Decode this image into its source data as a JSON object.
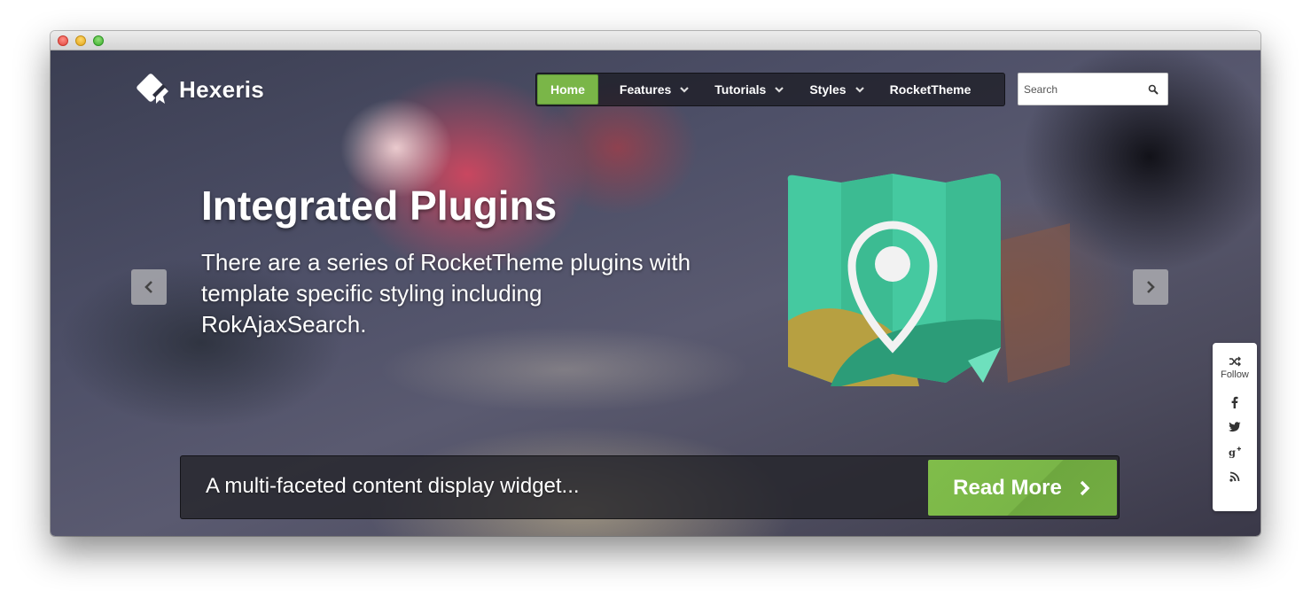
{
  "brand": {
    "name": "Hexeris",
    "accent_color": "#7ab648"
  },
  "nav": {
    "items": [
      {
        "label": "Home",
        "active": true,
        "has_dropdown": false
      },
      {
        "label": "Features",
        "active": false,
        "has_dropdown": true
      },
      {
        "label": "Tutorials",
        "active": false,
        "has_dropdown": true
      },
      {
        "label": "Styles",
        "active": false,
        "has_dropdown": true
      },
      {
        "label": "RocketTheme",
        "active": false,
        "has_dropdown": false
      }
    ]
  },
  "search": {
    "placeholder": "Search",
    "icon": "search-icon"
  },
  "slide": {
    "title": "Integrated Plugins",
    "description": "There are a series of RocketTheme plugins with template specific styling including RokAjaxSearch.",
    "illustration": "map-pin-icon",
    "prev_icon": "chevron-left-icon",
    "next_icon": "chevron-right-icon"
  },
  "caption": {
    "text": "A multi-faceted content display widget...",
    "button_label": "Read More"
  },
  "social": {
    "follow_label": "Follow",
    "icons": [
      "shuffle-icon",
      "facebook-icon",
      "twitter-icon",
      "google-plus-icon",
      "rss-icon"
    ]
  }
}
